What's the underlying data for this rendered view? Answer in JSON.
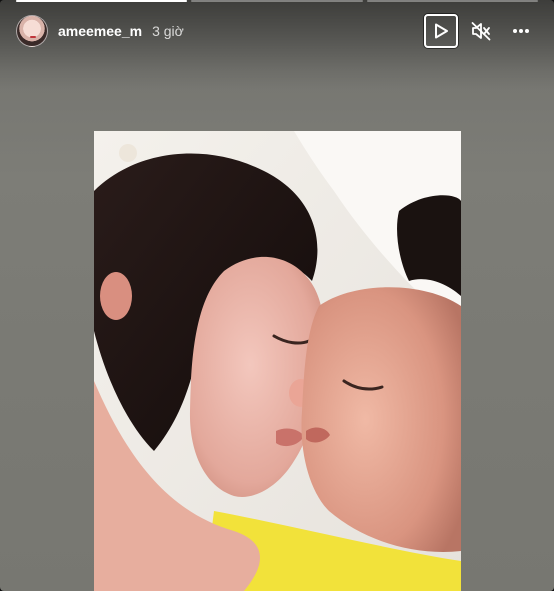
{
  "story": {
    "progress": [
      1,
      0,
      0
    ],
    "user": {
      "username": "ameemee_m",
      "time_ago": "3 giờ",
      "avatar_icon": "profile-avatar"
    },
    "controls": {
      "play_icon": "play-icon",
      "mute_icon": "muted-speaker-icon",
      "more_icon": "more-options-icon"
    }
  },
  "colors": {
    "background": "#7a7a74",
    "text": "#ffffff",
    "shirt_yellow": "#f2e23a"
  }
}
